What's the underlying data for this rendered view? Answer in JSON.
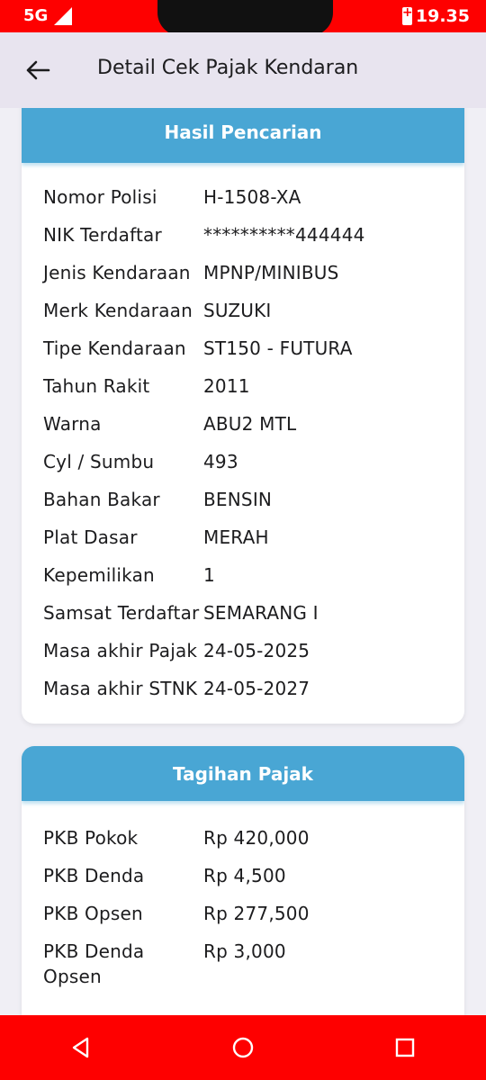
{
  "status_bar": {
    "network": "5G",
    "time": "19.35"
  },
  "app_bar": {
    "title": "Detail Cek Pajak Kendaran"
  },
  "vehicle_card": {
    "title": "Hasil Pencarian",
    "rows": [
      {
        "label": "Nomor Polisi",
        "value": "H-1508-XA"
      },
      {
        "label": "NIK Terdaftar",
        "value": "**********444444"
      },
      {
        "label": "Jenis Kendaraan",
        "value": "MPNP/MINIBUS"
      },
      {
        "label": "Merk Kendaraan",
        "value": "SUZUKI"
      },
      {
        "label": "Tipe Kendaraan",
        "value": "ST150 - FUTURA"
      },
      {
        "label": "Tahun Rakit",
        "value": "2011"
      },
      {
        "label": "Warna",
        "value": "ABU2 MTL"
      },
      {
        "label": "Cyl / Sumbu",
        "value": "493"
      },
      {
        "label": "Bahan Bakar",
        "value": "BENSIN"
      },
      {
        "label": "Plat Dasar",
        "value": "MERAH"
      },
      {
        "label": "Kepemilikan",
        "value": "1"
      },
      {
        "label": "Samsat Terdaftar",
        "value": "SEMARANG I"
      },
      {
        "label": "Masa akhir Pajak",
        "value": "24-05-2025"
      },
      {
        "label": "Masa akhir STNK",
        "value": "24-05-2027"
      }
    ]
  },
  "tax_card": {
    "title": "Tagihan Pajak",
    "rows": [
      {
        "label": "PKB Pokok",
        "value": "Rp 420,000"
      },
      {
        "label": "PKB Denda",
        "value": "Rp 4,500"
      },
      {
        "label": "PKB Opsen",
        "value": "Rp 277,500"
      },
      {
        "label": "PKB Denda Opsen",
        "value": "Rp 3,000"
      }
    ]
  },
  "colors": {
    "status_bar": "#fe0000",
    "card_header": "#49a6d4",
    "app_bar": "#e8e4ef",
    "nav_bar": "#fe0000"
  },
  "icons": {
    "back": "arrow-left-icon",
    "nav_back": "triangle-back-icon",
    "nav_home": "circle-home-icon",
    "nav_recents": "square-recents-icon"
  }
}
